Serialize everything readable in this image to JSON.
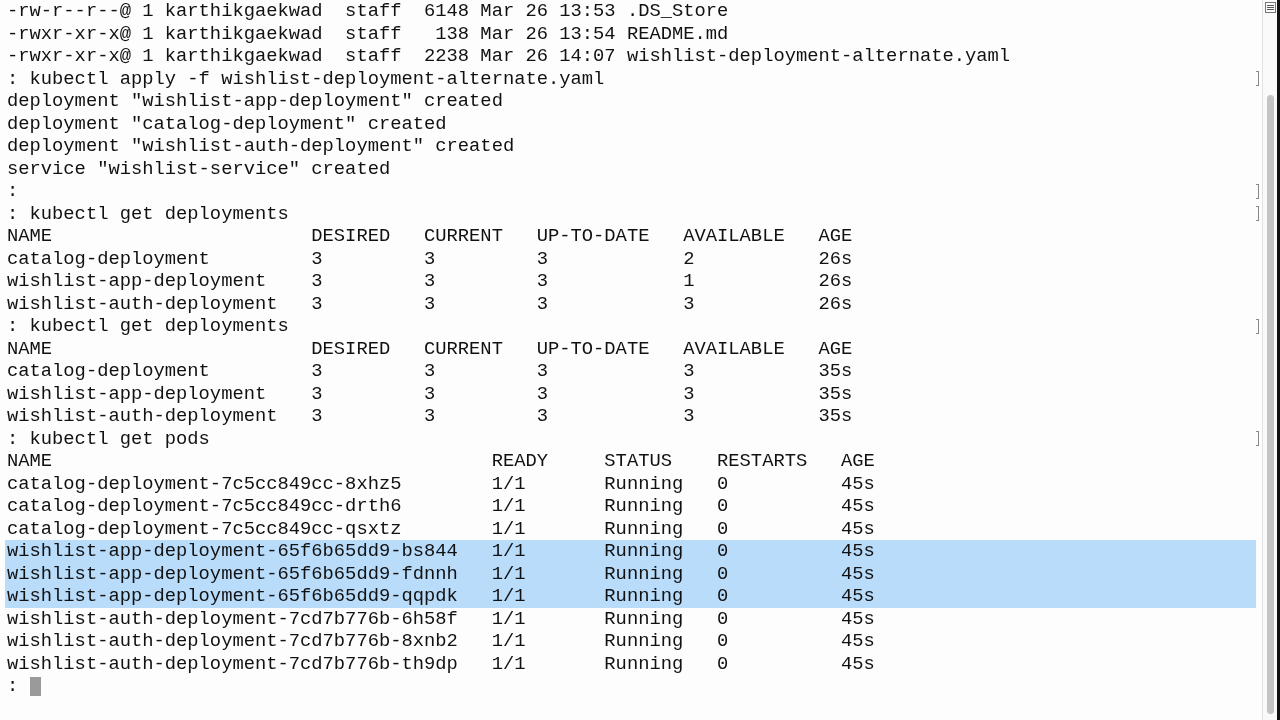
{
  "terminal": {
    "lines": [
      {
        "text": "-rw-r--r--@ 1 karthikgaekwad  staff  6148 Mar 26 13:53 .DS_Store",
        "selected": false,
        "marked": false,
        "cursor": false
      },
      {
        "text": "-rwxr-xr-x@ 1 karthikgaekwad  staff   138 Mar 26 13:54 README.md",
        "selected": false,
        "marked": false,
        "cursor": false
      },
      {
        "text": "-rwxr-xr-x@ 1 karthikgaekwad  staff  2238 Mar 26 14:07 wishlist-deployment-alternate.yaml",
        "selected": false,
        "marked": false,
        "cursor": false
      },
      {
        "text": ": kubectl apply -f wishlist-deployment-alternate.yaml",
        "selected": false,
        "marked": true,
        "cursor": false
      },
      {
        "text": "deployment \"wishlist-app-deployment\" created",
        "selected": false,
        "marked": false,
        "cursor": false
      },
      {
        "text": "deployment \"catalog-deployment\" created",
        "selected": false,
        "marked": false,
        "cursor": false
      },
      {
        "text": "deployment \"wishlist-auth-deployment\" created",
        "selected": false,
        "marked": false,
        "cursor": false
      },
      {
        "text": "service \"wishlist-service\" created",
        "selected": false,
        "marked": false,
        "cursor": false
      },
      {
        "text": ":",
        "selected": false,
        "marked": true,
        "cursor": false
      },
      {
        "text": ": kubectl get deployments",
        "selected": false,
        "marked": true,
        "cursor": false
      },
      {
        "text": "NAME                       DESIRED   CURRENT   UP-TO-DATE   AVAILABLE   AGE",
        "selected": false,
        "marked": false,
        "cursor": false
      },
      {
        "text": "catalog-deployment         3         3         3            2           26s",
        "selected": false,
        "marked": false,
        "cursor": false
      },
      {
        "text": "wishlist-app-deployment    3         3         3            1           26s",
        "selected": false,
        "marked": false,
        "cursor": false
      },
      {
        "text": "wishlist-auth-deployment   3         3         3            3           26s",
        "selected": false,
        "marked": false,
        "cursor": false
      },
      {
        "text": ": kubectl get deployments",
        "selected": false,
        "marked": true,
        "cursor": false
      },
      {
        "text": "NAME                       DESIRED   CURRENT   UP-TO-DATE   AVAILABLE   AGE",
        "selected": false,
        "marked": false,
        "cursor": false
      },
      {
        "text": "catalog-deployment         3         3         3            3           35s",
        "selected": false,
        "marked": false,
        "cursor": false
      },
      {
        "text": "wishlist-app-deployment    3         3         3            3           35s",
        "selected": false,
        "marked": false,
        "cursor": false
      },
      {
        "text": "wishlist-auth-deployment   3         3         3            3           35s",
        "selected": false,
        "marked": false,
        "cursor": false
      },
      {
        "text": ": kubectl get pods",
        "selected": false,
        "marked": true,
        "cursor": false
      },
      {
        "text": "NAME                                       READY     STATUS    RESTARTS   AGE",
        "selected": false,
        "marked": false,
        "cursor": false
      },
      {
        "text": "catalog-deployment-7c5cc849cc-8xhz5        1/1       Running   0          45s",
        "selected": false,
        "marked": false,
        "cursor": false
      },
      {
        "text": "catalog-deployment-7c5cc849cc-drth6        1/1       Running   0          45s",
        "selected": false,
        "marked": false,
        "cursor": false
      },
      {
        "text": "catalog-deployment-7c5cc849cc-qsxtz        1/1       Running   0          45s",
        "selected": false,
        "marked": false,
        "cursor": false
      },
      {
        "text": "wishlist-app-deployment-65f6b65dd9-bs844   1/1       Running   0          45s",
        "selected": true,
        "marked": false,
        "cursor": false
      },
      {
        "text": "wishlist-app-deployment-65f6b65dd9-fdnnh   1/1       Running   0          45s",
        "selected": true,
        "marked": false,
        "cursor": false
      },
      {
        "text": "wishlist-app-deployment-65f6b65dd9-qqpdk   1/1       Running   0          45s",
        "selected": true,
        "marked": false,
        "cursor": false
      },
      {
        "text": "wishlist-auth-deployment-7cd7b776b-6h58f   1/1       Running   0          45s",
        "selected": false,
        "marked": false,
        "cursor": false
      },
      {
        "text": "wishlist-auth-deployment-7cd7b776b-8xnb2   1/1       Running   0          45s",
        "selected": false,
        "marked": false,
        "cursor": false
      },
      {
        "text": "wishlist-auth-deployment-7cd7b776b-th9dp   1/1       Running   0          45s",
        "selected": false,
        "marked": false,
        "cursor": false
      },
      {
        "text": ":",
        "selected": false,
        "marked": false,
        "cursor": true
      }
    ]
  }
}
